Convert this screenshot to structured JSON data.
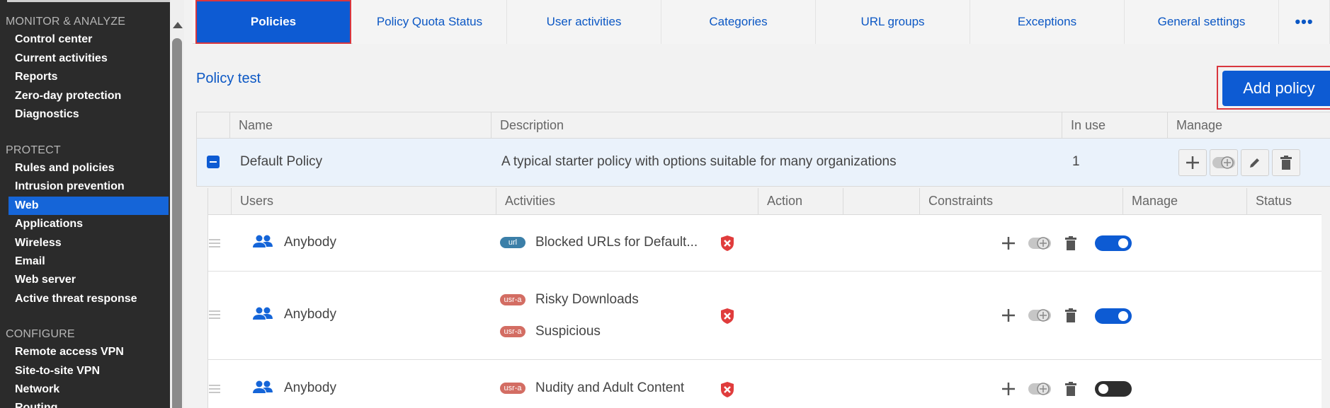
{
  "sidebar": {
    "sections": [
      {
        "title": "MONITOR & ANALYZE",
        "items": [
          "Control center",
          "Current activities",
          "Reports",
          "Zero-day protection",
          "Diagnostics"
        ]
      },
      {
        "title": "PROTECT",
        "items": [
          "Rules and policies",
          "Intrusion prevention",
          "Web",
          "Applications",
          "Wireless",
          "Email",
          "Web server",
          "Active threat response"
        ]
      },
      {
        "title": "CONFIGURE",
        "items": [
          "Remote access VPN",
          "Site-to-site VPN",
          "Network",
          "Routing"
        ]
      }
    ],
    "active_item": "Web"
  },
  "tabs": [
    "Policies",
    "Policy Quota Status",
    "User activities",
    "Categories",
    "URL groups",
    "Exceptions",
    "General settings"
  ],
  "tabs_more": "•••",
  "active_tab": "Policies",
  "policy_title": "Policy test",
  "add_policy_label": "Add policy",
  "policy_table": {
    "headers": [
      "Name",
      "Description",
      "In use",
      "Manage"
    ],
    "row": {
      "name": "Default Policy",
      "description": "A typical starter policy with options suitable for many organizations",
      "in_use": "1"
    }
  },
  "rule_table": {
    "headers": [
      "Users",
      "Activities",
      "Action",
      "",
      "Constraints",
      "Manage",
      "Status"
    ],
    "rows": [
      {
        "user": "Anybody",
        "activities": [
          {
            "tag": "url",
            "label": "Blocked URLs for Default..."
          }
        ],
        "action": "block",
        "status": "on"
      },
      {
        "user": "Anybody",
        "activities": [
          {
            "tag": "usr-a",
            "label": "Risky Downloads"
          },
          {
            "tag": "usr-a",
            "label": "Suspicious"
          }
        ],
        "action": "block",
        "status": "on"
      },
      {
        "user": "Anybody",
        "activities": [
          {
            "tag": "usr-a",
            "label": "Nudity and Adult Content"
          }
        ],
        "action": "block",
        "status": "off"
      }
    ]
  },
  "colors": {
    "accent": "#0d5bd3",
    "highlight_border": "#d9363e",
    "sidebar_bg": "#2b2b2b",
    "block_red": "#e03c3c"
  }
}
